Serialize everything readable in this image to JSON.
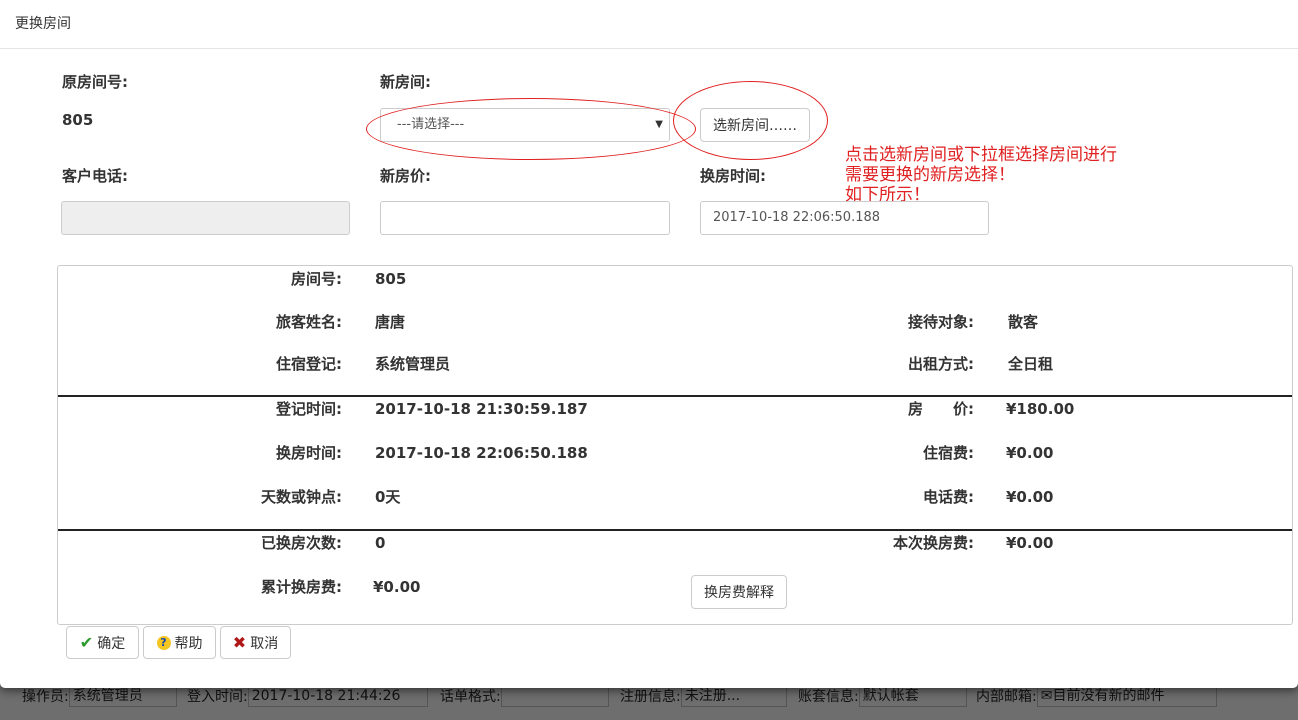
{
  "statusbar": {
    "operator_label": "操作员:",
    "operator_value": "系统管理员",
    "login_label": "登入时间:",
    "login_value": "2017-10-18 21:44:26",
    "bill_label": "话单格式:",
    "bill_value": "",
    "reg_label": "注册信息:",
    "reg_value": "未注册...",
    "account_label": "账套信息:",
    "account_value": "默认帐套",
    "mail_label": "内部邮箱:",
    "mail_value": "目前没有新的邮件"
  },
  "modal": {
    "title": "更换房间",
    "orig_room_label": "原房间号:",
    "orig_room_value": "805",
    "new_room_label": "新房间:",
    "select_value": "---请选择---",
    "select_new_room_button": "选新房间……",
    "phone_label": "客户电话:",
    "phone_value": "",
    "new_price_label": "新房价:",
    "new_price_value": "",
    "change_time_label": "换房时间:",
    "change_time_value": "2017-10-18 22:06:50.188",
    "annotation": [
      "点击选新房间或下拉框选择房间进行",
      "需要更换的新房选择！",
      "如下所示！"
    ]
  },
  "info": {
    "room_no_label": "房间号:",
    "room_no_value": "805",
    "guest_name_label": "旅客姓名:",
    "guest_name_value": "唐唐",
    "reception_label": "接待对象:",
    "reception_value": "散客",
    "registrar_label": "住宿登记:",
    "registrar_value": "系统管理员",
    "rent_mode_label": "出租方式:",
    "rent_mode_value": "全日租",
    "checkin_time_label": "登记时间:",
    "checkin_time_value": "2017-10-18 21:30:59.187",
    "room_price_label": "房　　价:",
    "room_price_value": "¥180.00",
    "change_time_label": "换房时间:",
    "change_time_value": "2017-10-18 22:06:50.188",
    "lodging_fee_label": "住宿费:",
    "lodging_fee_value": "¥0.00",
    "days_label": "天数或钟点:",
    "days_value": "0天",
    "phone_fee_label": "电话费:",
    "phone_fee_value": "¥0.00",
    "change_count_label": "已换房次数:",
    "change_count_value": "0",
    "this_change_fee_label": "本次换房费:",
    "this_change_fee_value": "¥0.00",
    "total_change_fee_label": "累计换房费:",
    "total_change_fee_value": "¥0.00",
    "fee_explain_button": "换房费解释"
  },
  "footer": {
    "ok": "确定",
    "help": "帮助",
    "cancel": "取消"
  },
  "colors": {
    "annotation": "#e02020",
    "check": "#2a9a2a",
    "cancel": "#b01818"
  }
}
